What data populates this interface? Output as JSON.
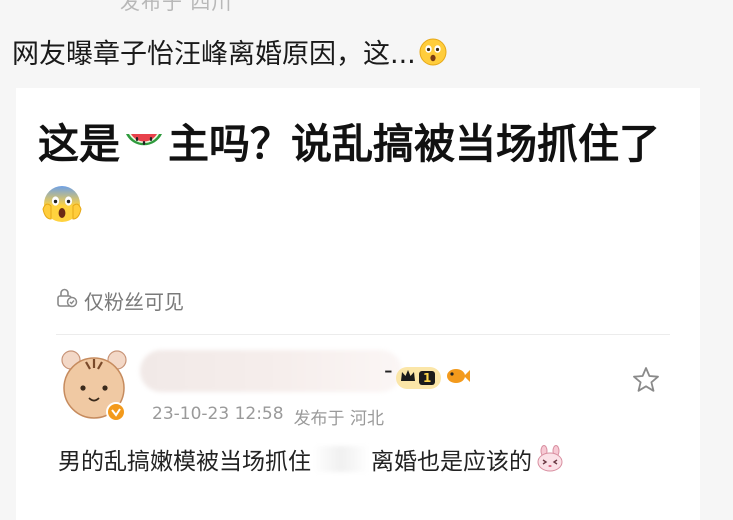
{
  "header": {
    "cut_text": "发布于 四川",
    "headline": "网友曝章子怡汪峰离婚原因，这..."
  },
  "post": {
    "text_part1": "这是",
    "text_part2": "主吗？说乱搞被当场抓住了",
    "visibility": "仅粉丝可见"
  },
  "comment": {
    "name_suffix": "-",
    "level": "1",
    "timestamp": "23-10-23 12:58",
    "source": "发布于 河北",
    "text_part1": "男的乱搞嫩模被当场抓住",
    "text_part2": "离婚也是应该的"
  },
  "icons": {
    "headline_emoji": "astonished-face-icon",
    "watermelon": "watermelon-icon",
    "scream": "screaming-face-icon",
    "lock": "visibility-lock-icon",
    "star": "favorite-star-icon",
    "bunny": "bunny-face-icon"
  },
  "colors": {
    "badge_gold": "#fbe6a8",
    "verified_orange": "#f39a1c",
    "watermelon_red": "#e8414b"
  }
}
